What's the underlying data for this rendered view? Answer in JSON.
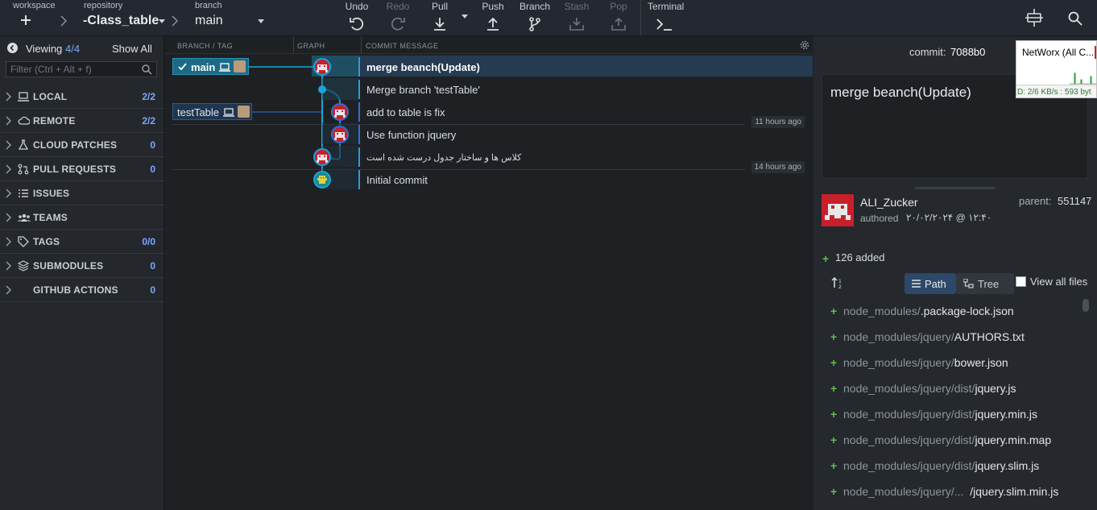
{
  "toolbar": {
    "workspace_label": "workspace",
    "repository_label": "repository",
    "repository_value": "-Class_table",
    "branch_label": "branch",
    "branch_value": "main",
    "undo": "Undo",
    "redo": "Redo",
    "pull": "Pull",
    "push": "Push",
    "branch": "Branch",
    "stash": "Stash",
    "pop": "Pop",
    "terminal": "Terminal"
  },
  "sidebar": {
    "viewing_label": "Viewing",
    "viewing_count": "4/4",
    "show_all": "Show All",
    "filter_placeholder": "Filter (Ctrl + Alt + f)",
    "sections": [
      {
        "name": "LOCAL",
        "count": "2/2"
      },
      {
        "name": "REMOTE",
        "count": "2/2"
      },
      {
        "name": "CLOUD PATCHES",
        "count": "0"
      },
      {
        "name": "PULL REQUESTS",
        "count": "0"
      },
      {
        "name": "ISSUES",
        "count": ""
      },
      {
        "name": "TEAMS",
        "count": ""
      },
      {
        "name": "TAGS",
        "count": "0/0"
      },
      {
        "name": "SUBMODULES",
        "count": "0"
      },
      {
        "name": "GITHUB ACTIONS",
        "count": "0"
      }
    ]
  },
  "graph": {
    "col_branch": "BRANCH / TAG",
    "col_graph": "GRAPH",
    "col_message": "COMMIT MESSAGE",
    "branch_main": "main",
    "branch_test": "testTable",
    "commits": [
      {
        "message": "merge beanch(Update)"
      },
      {
        "message": "Merge branch 'testTable'"
      },
      {
        "message": "add to table is fix"
      },
      {
        "message": "Use function jquery"
      },
      {
        "message": "کلاس ها و ساختار جدول درست شده است"
      },
      {
        "message": "Initial commit"
      }
    ],
    "time_1": "11 hours ago",
    "time_2": "14 hours ago"
  },
  "details": {
    "commit_label": "commit:",
    "commit_hash": "7088b0",
    "message": "merge beanch(Update)",
    "author": "ALI_Zucker",
    "authored_label": "authored",
    "authored_date": "۲۰/۰۲/۲۰۲۴ @ ۱۲:۴۰",
    "parent_label": "parent:",
    "parent_hash": "551147",
    "added": "126 added",
    "path_tab": "Path",
    "tree_tab": "Tree",
    "view_all": "View all files",
    "files": [
      {
        "dir": "node_modules/",
        "name": ".package-lock.json"
      },
      {
        "dir": "node_modules/jquery/",
        "name": "AUTHORS.txt"
      },
      {
        "dir": "node_modules/jquery/",
        "name": "bower.json"
      },
      {
        "dir": "node_modules/jquery/dist/",
        "name": "jquery.js"
      },
      {
        "dir": "node_modules/jquery/dist/",
        "name": "jquery.min.js"
      },
      {
        "dir": "node_modules/jquery/dist/",
        "name": "jquery.min.map"
      },
      {
        "dir": "node_modules/jquery/dist/",
        "name": "jquery.slim.js"
      },
      {
        "dir": "node_modules/jquery/...",
        "name": "/jquery.slim.min.js"
      }
    ]
  },
  "popup": {
    "title": "NetWorx (All C...",
    "stats": "D: 2/6 KB/s : 593 byt"
  },
  "colors": {
    "accent": "#2f9bd6",
    "count": "#7aa8ff",
    "added": "#5fbf4b"
  }
}
